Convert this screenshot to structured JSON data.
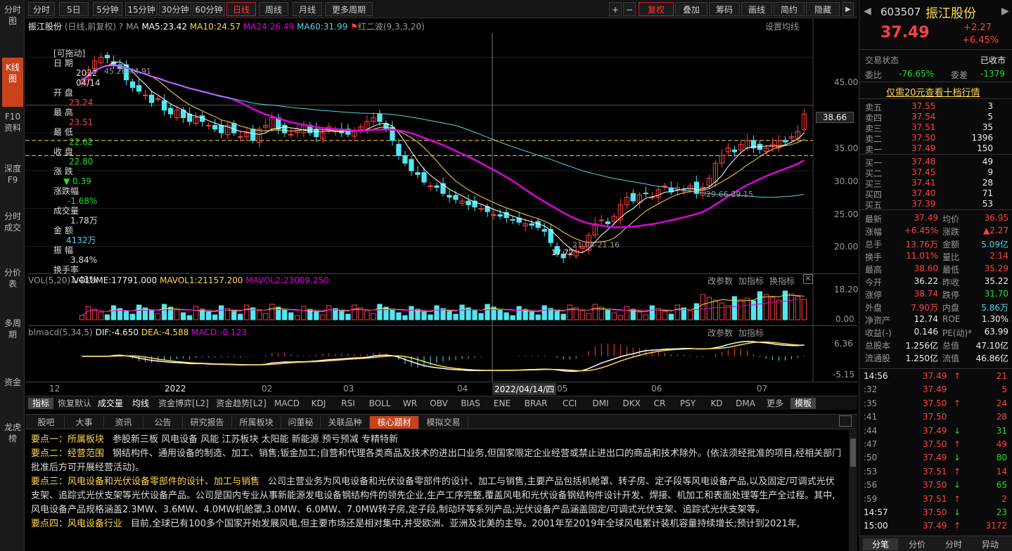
{
  "left_nav": [
    "分时图",
    "K线图",
    "F10资料",
    "深度F9",
    "分时成交",
    "分价表",
    "多周期",
    "资金",
    "龙虎榜"
  ],
  "top_tabs": [
    "分时",
    "5日",
    "5分钟",
    "15分钟",
    "30分钟",
    "60分钟",
    "日线",
    "周线",
    "月线",
    "更多周期"
  ],
  "top_right": [
    "+",
    "−",
    "复权",
    "叠加",
    "筹码",
    "画线",
    "简约",
    "隐藏"
  ],
  "chart_header": {
    "name": "振江股份",
    "mode": "(日线,前复权)",
    "help": "?",
    "ma": "MA",
    "ma5": "MA5:23.42",
    "ma10": "MA10:24.57",
    "ma24": "MA24:26.49",
    "ma60": "MA60:31.99",
    "signal": "红二波(9,3,3,20)",
    "set_ma": "设置均线"
  },
  "vol_header": {
    "name": "VOL(5,20)",
    "vol": "VOLUME:17791.000",
    "mavol1": "MAVOL1:21157.200",
    "mavol2": "MAVOL2:23009.250",
    "btns": [
      "改参数",
      "加指标",
      "换指标"
    ]
  },
  "macd_header": {
    "name": "blmacd(5,34,5)",
    "dif": "DIF:-4.650",
    "dea": "DEA:-4.588",
    "macd": "MACD:-0.123",
    "btns": [
      "改参数",
      "加指标"
    ]
  },
  "info_panel": {
    "draggable": "[可拖动]",
    "date_label": "日 期",
    "year": "2022",
    "date": "04/14",
    "open_label": "开 盘",
    "open": "23.24",
    "high_label": "最 高",
    "high": "23.51",
    "low_label": "最 低",
    "low": "22.62",
    "close_label": "收 盘",
    "close": "22.80",
    "chg_label": "涨 跌",
    "chg": "0.39",
    "chgp_label": "涨跌幅",
    "chgp": "-1.68%",
    "vol_label": "成交量",
    "vol": "1.78万",
    "amt_label": "金 额",
    "amt": "4132万",
    "amp_label": "振 幅",
    "amp": "3.84%",
    "turn_label": "换手率",
    "turn": "1.43%"
  },
  "price_axis": [
    "45.00",
    "38.66",
    "35.00",
    "30.00",
    "25.00",
    "20.00"
  ],
  "vol_axis": [
    "18.20",
    "0.00"
  ],
  "macd_axis": [
    "6.36",
    "-5.15"
  ],
  "annotations": {
    "high": "45.28-44.91",
    "mid": "29.66-29.15",
    "low": "17.72",
    "low2": "21.04-21.16"
  },
  "x_axis": [
    "12",
    "2022",
    "02",
    "03",
    "04",
    "2022/04/14/四",
    "05",
    "06",
    "07"
  ],
  "ind_tabs": [
    "指标",
    "恢复默认",
    "成交量",
    "均线",
    "资金博弈[L2]",
    "资金趋势[L2]",
    "MACD",
    "KDJ",
    "RSI",
    "BOLL",
    "WR",
    "OBV",
    "BIAS",
    "ENE",
    "BRAR",
    "CCI",
    "DMI",
    "DKX",
    "CR",
    "PSY",
    "KD",
    "DMA",
    "更多",
    "模板"
  ],
  "f10_tabs": [
    "股吧",
    "大事",
    "资讯",
    "公告",
    "研究报告",
    "所属板块",
    "问董秘",
    "关联品种",
    "核心题材",
    "模拟交易"
  ],
  "f10_text": [
    {
      "k": "要点一：所属板块",
      "v": "参股新三板 风电设备 风能 江苏板块 太阳能 新能源 预亏预减 专精特新"
    },
    {
      "k": "要点二：经营范围",
      "v": "钢结构件、通用设备的制造、加工、销售;钣金加工;自营和代理各类商品及技术的进出口业务,但国家限定企业经营或禁止进出口的商品和技术除外。(依法须经批准的项目,经相关部门批准后方可开展经营活动)。"
    },
    {
      "k": "要点三：风电设备和光伏设备零部件的设计、加工与销售",
      "v": "公司主营业务为风电设备和光伏设备零部件的设计、加工与销售,主要产品包括机舱罩、转子房、定子段等风电设备产品,以及固定/可调式光伏支架、追踪式光伏支架等光伏设备产品。公司是国内专业从事新能源发电设备钢结构件的领先企业,生产工序完整,覆盖风电和光伏设备钢结构件设计开发、焊接、机加工和表面处理等生产全过程。其中,风电设备产品规格涵盖2.3MW、3.6MW、4.0MW机舱罩,3.0MW、6.0MW、7.0MW转子房,定子段,制动环等系列产品;光伏设备产品涵盖固定/可调式光伏支架、追踪式光伏支架等。"
    },
    {
      "k": "要点四：风电设备行业",
      "v": "目前,全球已有100多个国家开始发展风电,但主要市场还是相对集中,并受欧洲、亚洲及北美的主导。2001年至2019年全球风电累计装机容量持续增长;预计到2021年,"
    }
  ],
  "quote": {
    "code": "603507",
    "name": "振江股份",
    "price": "37.49",
    "change": "+2.27",
    "pct": "+6.45%",
    "status_label": "交易状态",
    "status": "已收市",
    "wb_label": "委比",
    "wb": "-76.65%",
    "wc_label": "委差",
    "wc": "-1379",
    "promo": "仅需20元查看十档行情"
  },
  "asks": [
    [
      "卖五",
      "37.55",
      "3"
    ],
    [
      "卖四",
      "37.54",
      "5"
    ],
    [
      "卖三",
      "37.51",
      "35"
    ],
    [
      "卖二",
      "37.50",
      "1396"
    ],
    [
      "卖一",
      "37.49",
      "150"
    ]
  ],
  "bids": [
    [
      "买一",
      "37.48",
      "49"
    ],
    [
      "买二",
      "37.45",
      "9"
    ],
    [
      "买三",
      "37.41",
      "28"
    ],
    [
      "买四",
      "37.40",
      "71"
    ],
    [
      "买五",
      "37.39",
      "53"
    ]
  ],
  "stats": [
    [
      "最新",
      "37.49",
      "均价",
      "36.95"
    ],
    [
      "涨幅",
      "+6.45%",
      "涨跌",
      "▲2.27"
    ],
    [
      "总手",
      "13.76万",
      "金额",
      "5.09亿"
    ],
    [
      "换手",
      "11.01%",
      "量比",
      "2.14"
    ],
    [
      "最高",
      "38.60",
      "最低",
      "35.29"
    ],
    [
      "今开",
      "36.22",
      "昨收",
      "35.22"
    ],
    [
      "涨停",
      "38.74",
      "跌停",
      "31.70"
    ],
    [
      "外盘",
      "7.90万",
      "内盘",
      "5.86万"
    ],
    [
      "净资产",
      "12.74",
      "ROE",
      "1.30%"
    ],
    [
      "收益(-)",
      "0.146",
      "PE(动)*",
      "63.99"
    ],
    [
      "总股本",
      "1.256亿",
      "总值",
      "47.10亿"
    ],
    [
      "流通股",
      "1.250亿",
      "流值",
      "46.86亿"
    ]
  ],
  "ticks": [
    [
      "14:56",
      "37.49",
      "↑",
      "21"
    ],
    [
      ":32",
      "37.49",
      "",
      "5"
    ],
    [
      ":35",
      "37.50",
      "↑",
      "24"
    ],
    [
      ":41",
      "37.50",
      "",
      "28"
    ],
    [
      ":44",
      "37.49",
      "↓",
      "31"
    ],
    [
      ":47",
      "37.50",
      "↑",
      "49"
    ],
    [
      ":50",
      "37.49",
      "↓",
      "80"
    ],
    [
      ":53",
      "37.51",
      "↑",
      "14"
    ],
    [
      ":56",
      "37.50",
      "↓",
      "65"
    ],
    [
      ":59",
      "37.51",
      "↑",
      "2"
    ],
    [
      "14:57",
      "37.50",
      "↓",
      "23"
    ],
    [
      "15:00",
      "37.49",
      "↑",
      "3172"
    ]
  ],
  "bottom_tabs": [
    "分笔",
    "分价",
    "分时",
    "异动"
  ],
  "colors": {
    "up": "#ff4040",
    "down": "#21e121",
    "ma5": "#ffffff",
    "ma10": "#ffd84a",
    "ma24": "#e000e0",
    "ma60": "#4fd6e6",
    "candle_up": "#ff4040",
    "candle_down": "#54e6f0"
  },
  "chart_data": {
    "type": "candlestick",
    "ylim": [
      17,
      48
    ],
    "closes": [
      42,
      43,
      44.5,
      45,
      44.9,
      44,
      43.5,
      42,
      41,
      40.5,
      40,
      39,
      39.5,
      38,
      37.5,
      38,
      37,
      36.5,
      37,
      36.5,
      36,
      35.5,
      35,
      36,
      35,
      34.5,
      35,
      34,
      35.5,
      36,
      37,
      35.5,
      35,
      34.8,
      35.5,
      36,
      35,
      34.5,
      35,
      35.8,
      35.5,
      35,
      34.8,
      35.2,
      35.8,
      36.5,
      37,
      36.5,
      35.5,
      34,
      32,
      31,
      30,
      29.5,
      28.5,
      28,
      27.8,
      27,
      26.5,
      26.2,
      26,
      25.5,
      25.2,
      25,
      24.6,
      24.2,
      24,
      23.8,
      23.5,
      23.2,
      23,
      22.8,
      22.5,
      22,
      20.5,
      19,
      18.5,
      19,
      19.5,
      20,
      21.5,
      23,
      23.5,
      23,
      24,
      25.5,
      26.5,
      26,
      26.8,
      27,
      26.5,
      27.5,
      28,
      27.2,
      27.8,
      27.5,
      28,
      27,
      27.8,
      29,
      31,
      32,
      33,
      32.5,
      33.5,
      34,
      33,
      32.8,
      33,
      33.5,
      34,
      33.8,
      34.5,
      35.2,
      37.49
    ]
  }
}
